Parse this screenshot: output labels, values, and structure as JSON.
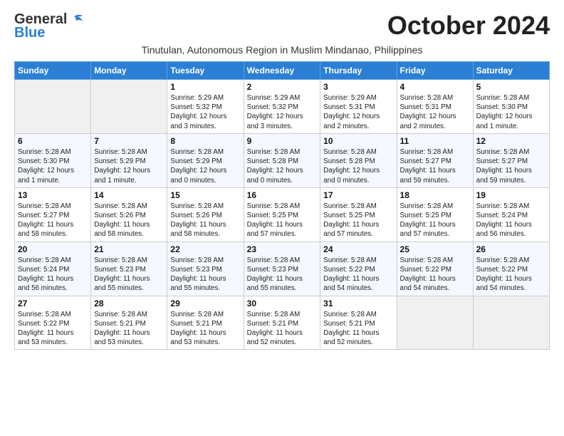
{
  "logo": {
    "line1": "General",
    "line2": "Blue"
  },
  "title": "October 2024",
  "subtitle": "Tinutulan, Autonomous Region in Muslim Mindanao, Philippines",
  "weekdays": [
    "Sunday",
    "Monday",
    "Tuesday",
    "Wednesday",
    "Thursday",
    "Friday",
    "Saturday"
  ],
  "weeks": [
    [
      {
        "day": "",
        "text": ""
      },
      {
        "day": "",
        "text": ""
      },
      {
        "day": "1",
        "text": "Sunrise: 5:29 AM\nSunset: 5:32 PM\nDaylight: 12 hours\nand 3 minutes."
      },
      {
        "day": "2",
        "text": "Sunrise: 5:29 AM\nSunset: 5:32 PM\nDaylight: 12 hours\nand 3 minutes."
      },
      {
        "day": "3",
        "text": "Sunrise: 5:29 AM\nSunset: 5:31 PM\nDaylight: 12 hours\nand 2 minutes."
      },
      {
        "day": "4",
        "text": "Sunrise: 5:28 AM\nSunset: 5:31 PM\nDaylight: 12 hours\nand 2 minutes."
      },
      {
        "day": "5",
        "text": "Sunrise: 5:28 AM\nSunset: 5:30 PM\nDaylight: 12 hours\nand 1 minute."
      }
    ],
    [
      {
        "day": "6",
        "text": "Sunrise: 5:28 AM\nSunset: 5:30 PM\nDaylight: 12 hours\nand 1 minute."
      },
      {
        "day": "7",
        "text": "Sunrise: 5:28 AM\nSunset: 5:29 PM\nDaylight: 12 hours\nand 1 minute."
      },
      {
        "day": "8",
        "text": "Sunrise: 5:28 AM\nSunset: 5:29 PM\nDaylight: 12 hours\nand 0 minutes."
      },
      {
        "day": "9",
        "text": "Sunrise: 5:28 AM\nSunset: 5:28 PM\nDaylight: 12 hours\nand 0 minutes."
      },
      {
        "day": "10",
        "text": "Sunrise: 5:28 AM\nSunset: 5:28 PM\nDaylight: 12 hours\nand 0 minutes."
      },
      {
        "day": "11",
        "text": "Sunrise: 5:28 AM\nSunset: 5:27 PM\nDaylight: 11 hours\nand 59 minutes."
      },
      {
        "day": "12",
        "text": "Sunrise: 5:28 AM\nSunset: 5:27 PM\nDaylight: 11 hours\nand 59 minutes."
      }
    ],
    [
      {
        "day": "13",
        "text": "Sunrise: 5:28 AM\nSunset: 5:27 PM\nDaylight: 11 hours\nand 58 minutes."
      },
      {
        "day": "14",
        "text": "Sunrise: 5:28 AM\nSunset: 5:26 PM\nDaylight: 11 hours\nand 58 minutes."
      },
      {
        "day": "15",
        "text": "Sunrise: 5:28 AM\nSunset: 5:26 PM\nDaylight: 11 hours\nand 58 minutes."
      },
      {
        "day": "16",
        "text": "Sunrise: 5:28 AM\nSunset: 5:25 PM\nDaylight: 11 hours\nand 57 minutes."
      },
      {
        "day": "17",
        "text": "Sunrise: 5:28 AM\nSunset: 5:25 PM\nDaylight: 11 hours\nand 57 minutes."
      },
      {
        "day": "18",
        "text": "Sunrise: 5:28 AM\nSunset: 5:25 PM\nDaylight: 11 hours\nand 57 minutes."
      },
      {
        "day": "19",
        "text": "Sunrise: 5:28 AM\nSunset: 5:24 PM\nDaylight: 11 hours\nand 56 minutes."
      }
    ],
    [
      {
        "day": "20",
        "text": "Sunrise: 5:28 AM\nSunset: 5:24 PM\nDaylight: 11 hours\nand 56 minutes."
      },
      {
        "day": "21",
        "text": "Sunrise: 5:28 AM\nSunset: 5:23 PM\nDaylight: 11 hours\nand 55 minutes."
      },
      {
        "day": "22",
        "text": "Sunrise: 5:28 AM\nSunset: 5:23 PM\nDaylight: 11 hours\nand 55 minutes."
      },
      {
        "day": "23",
        "text": "Sunrise: 5:28 AM\nSunset: 5:23 PM\nDaylight: 11 hours\nand 55 minutes."
      },
      {
        "day": "24",
        "text": "Sunrise: 5:28 AM\nSunset: 5:22 PM\nDaylight: 11 hours\nand 54 minutes."
      },
      {
        "day": "25",
        "text": "Sunrise: 5:28 AM\nSunset: 5:22 PM\nDaylight: 11 hours\nand 54 minutes."
      },
      {
        "day": "26",
        "text": "Sunrise: 5:28 AM\nSunset: 5:22 PM\nDaylight: 11 hours\nand 54 minutes."
      }
    ],
    [
      {
        "day": "27",
        "text": "Sunrise: 5:28 AM\nSunset: 5:22 PM\nDaylight: 11 hours\nand 53 minutes."
      },
      {
        "day": "28",
        "text": "Sunrise: 5:28 AM\nSunset: 5:21 PM\nDaylight: 11 hours\nand 53 minutes."
      },
      {
        "day": "29",
        "text": "Sunrise: 5:28 AM\nSunset: 5:21 PM\nDaylight: 11 hours\nand 53 minutes."
      },
      {
        "day": "30",
        "text": "Sunrise: 5:28 AM\nSunset: 5:21 PM\nDaylight: 11 hours\nand 52 minutes."
      },
      {
        "day": "31",
        "text": "Sunrise: 5:28 AM\nSunset: 5:21 PM\nDaylight: 11 hours\nand 52 minutes."
      },
      {
        "day": "",
        "text": ""
      },
      {
        "day": "",
        "text": ""
      }
    ]
  ]
}
